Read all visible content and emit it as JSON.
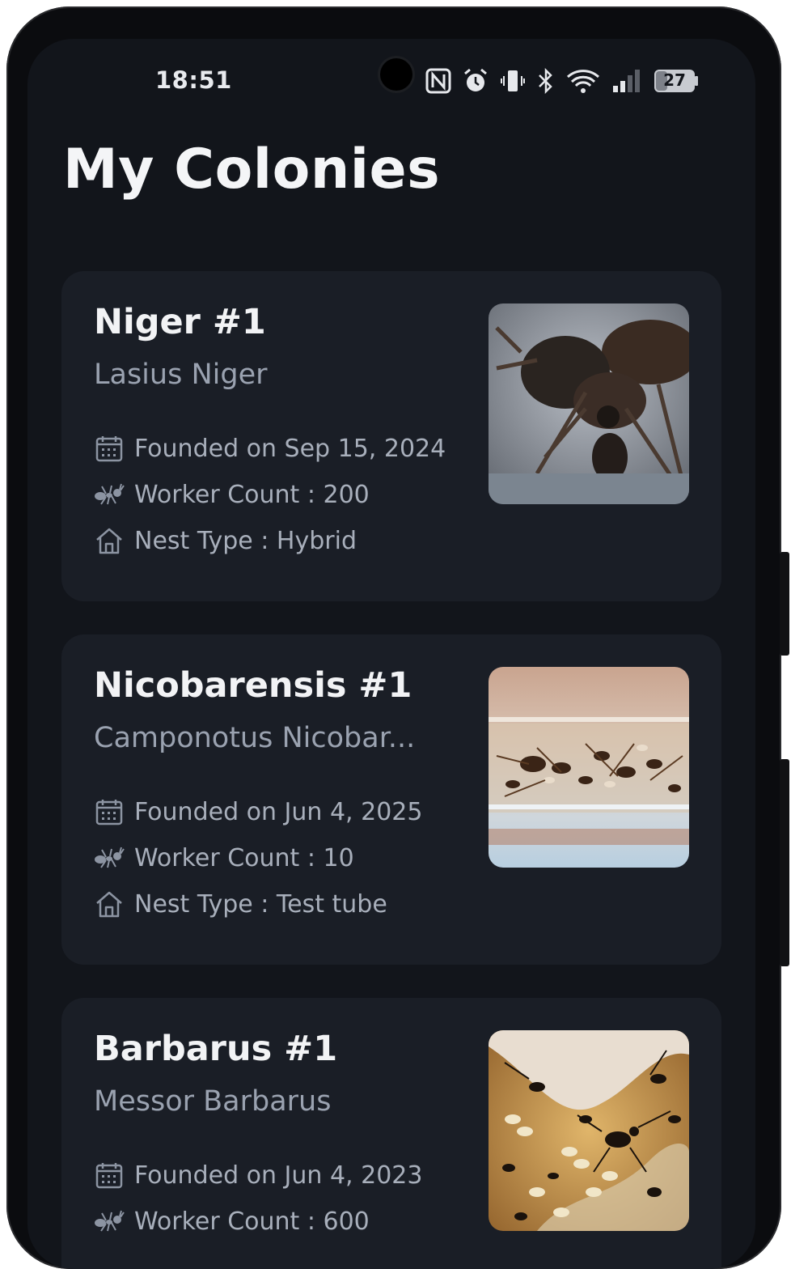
{
  "status_bar": {
    "time": "18:51",
    "battery": "27",
    "icons": [
      "nfc-icon",
      "alarm-icon",
      "vibrate-icon",
      "bluetooth-icon",
      "wifi-icon",
      "signal-icon",
      "battery-icon"
    ]
  },
  "page": {
    "title": "My Colonies"
  },
  "colonies": [
    {
      "name": "Niger #1",
      "species": "Lasius Niger",
      "founded": "Founded on Sep 15, 2024",
      "workers": "Worker Count : 200",
      "nest": "Nest Type : Hybrid"
    },
    {
      "name": "Nicobarensis #1",
      "species": "Camponotus Nicobar...",
      "founded": "Founded on Jun 4, 2025",
      "workers": "Worker Count : 10",
      "nest": "Nest Type : Test tube"
    },
    {
      "name": "Barbarus #1",
      "species": "Messor Barbarus",
      "founded": "Founded on Jun 4, 2023",
      "workers": "Worker Count : 600",
      "nest": ""
    }
  ],
  "colors": {
    "background": "#12151b",
    "card": "#1a1e26",
    "title": "#f4f5f7",
    "muted": "#9aa2b0"
  }
}
